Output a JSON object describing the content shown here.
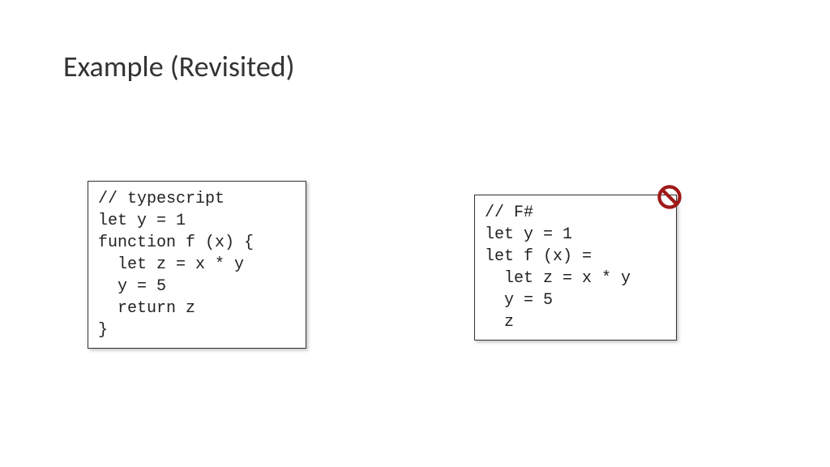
{
  "title": "Example (Revisited)",
  "leftCode": "// typescript\nlet y = 1\nfunction f (x) {\n  let z = x * y\n  y = 5\n  return z\n}",
  "rightCode": "// F#\nlet y = 1\nlet f (x) =\n  let z = x * y\n  y = 5\n  z",
  "iconName": "prohibited-icon"
}
